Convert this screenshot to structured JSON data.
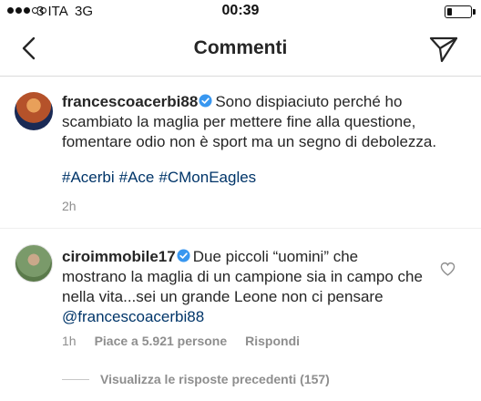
{
  "status_bar": {
    "carrier": "3 ITA",
    "network": "3G",
    "time": "00:39",
    "signal_bars_filled": 3,
    "signal_bars_total": 5,
    "battery_level": 0.2
  },
  "header": {
    "title": "Commenti",
    "back_icon": "chevron-left-icon",
    "send_icon": "paper-plane-icon"
  },
  "caption": {
    "username": "francescoacerbi88",
    "verified": true,
    "text": "Sono dispiaciuto perché ho scambiato la maglia per mettere fine alla questione, fomentare odio non è sport ma un segno di debolezza.",
    "hashtags": [
      "#Acerbi",
      "#Ace",
      "#CMonEagles"
    ],
    "time": "2h"
  },
  "comment": {
    "username": "ciroimmobile17",
    "verified": true,
    "text": "Due piccoli “uomini” che mostrano la maglia di un campione sia in campo che nella vita...sei un grande Leone non ci pensare ",
    "mention": "@francescoacerbi88",
    "time": "1h",
    "likes": "Piace a 5.921 persone",
    "reply_label": "Rispondi"
  },
  "view_replies": {
    "label": "Visualizza le risposte precedenti (157)"
  },
  "colors": {
    "verified_blue": "#3897f0",
    "link_blue": "#003569",
    "meta_gray": "#8e8e8e",
    "text": "#262626"
  }
}
